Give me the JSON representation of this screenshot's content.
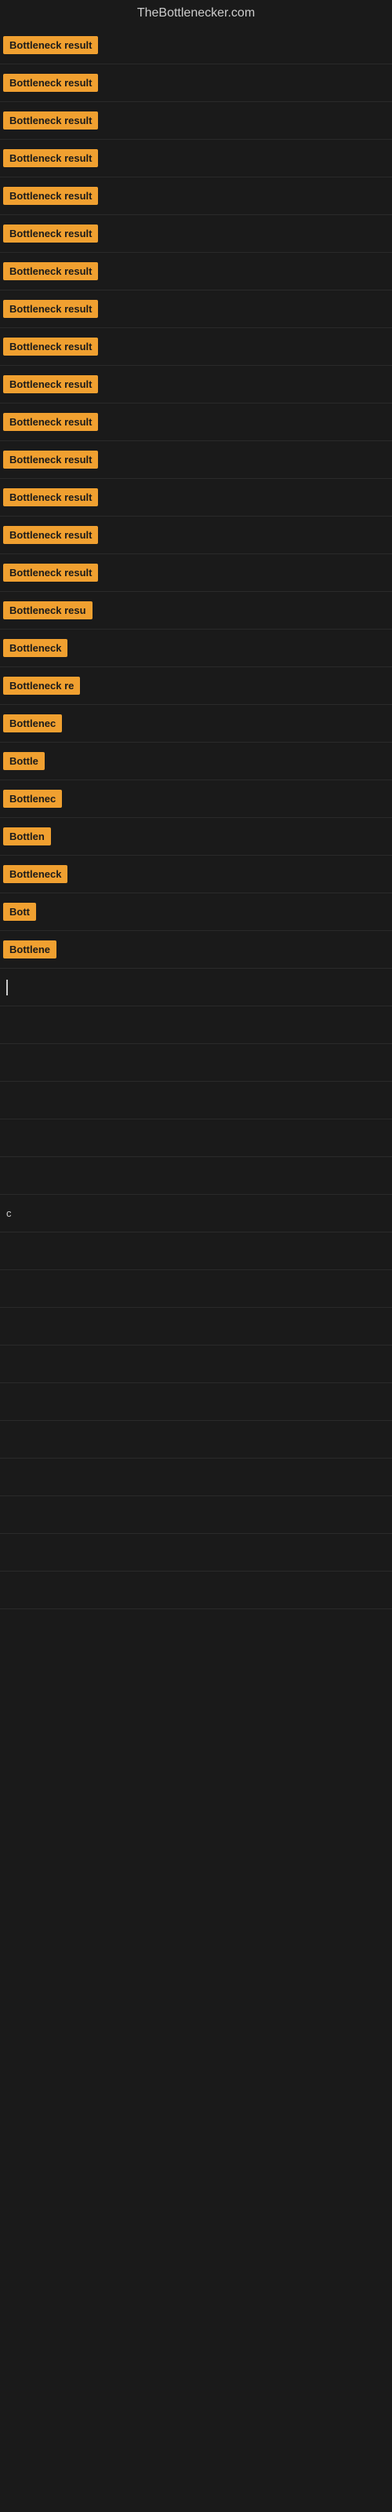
{
  "site": {
    "title": "TheBottlenecker.com"
  },
  "rows": [
    {
      "label": "Bottleneck result",
      "visible_chars": 17,
      "row_type": "full"
    },
    {
      "label": "Bottleneck result",
      "visible_chars": 17,
      "row_type": "full"
    },
    {
      "label": "Bottleneck result",
      "visible_chars": 17,
      "row_type": "full"
    },
    {
      "label": "Bottleneck result",
      "visible_chars": 17,
      "row_type": "full"
    },
    {
      "label": "Bottleneck result",
      "visible_chars": 17,
      "row_type": "full"
    },
    {
      "label": "Bottleneck result",
      "visible_chars": 17,
      "row_type": "full"
    },
    {
      "label": "Bottleneck result",
      "visible_chars": 17,
      "row_type": "full"
    },
    {
      "label": "Bottleneck result",
      "visible_chars": 17,
      "row_type": "full"
    },
    {
      "label": "Bottleneck result",
      "visible_chars": 17,
      "row_type": "full"
    },
    {
      "label": "Bottleneck result",
      "visible_chars": 17,
      "row_type": "full"
    },
    {
      "label": "Bottleneck result",
      "visible_chars": 17,
      "row_type": "full"
    },
    {
      "label": "Bottleneck result",
      "visible_chars": 17,
      "row_type": "full"
    },
    {
      "label": "Bottleneck result",
      "visible_chars": 17,
      "row_type": "full"
    },
    {
      "label": "Bottleneck result",
      "visible_chars": 17,
      "row_type": "full"
    },
    {
      "label": "Bottleneck result",
      "visible_chars": 17,
      "row_type": "full"
    },
    {
      "label": "Bottleneck resu",
      "visible_chars": 15,
      "row_type": "partial"
    },
    {
      "label": "Bottleneck",
      "visible_chars": 10,
      "row_type": "short"
    },
    {
      "label": "Bottleneck re",
      "visible_chars": 13,
      "row_type": "partial2"
    },
    {
      "label": "Bottlenec",
      "visible_chars": 9,
      "row_type": "shorter"
    },
    {
      "label": "Bottle",
      "visible_chars": 6,
      "row_type": "vshort"
    },
    {
      "label": "Bottlenec",
      "visible_chars": 9,
      "row_type": "shorter"
    },
    {
      "label": "Bottlen",
      "visible_chars": 7,
      "row_type": "shorter2"
    },
    {
      "label": "Bottleneck",
      "visible_chars": 10,
      "row_type": "short"
    },
    {
      "label": "Bott",
      "visible_chars": 4,
      "row_type": "vvshort"
    },
    {
      "label": "Bottlene",
      "visible_chars": 8,
      "row_type": "shorter3"
    },
    {
      "label": "cursor",
      "visible_chars": 0,
      "row_type": "cursor"
    },
    {
      "label": "",
      "visible_chars": 0,
      "row_type": "empty"
    },
    {
      "label": "",
      "visible_chars": 0,
      "row_type": "empty"
    },
    {
      "label": "",
      "visible_chars": 0,
      "row_type": "empty"
    },
    {
      "label": "",
      "visible_chars": 0,
      "row_type": "empty"
    },
    {
      "label": "",
      "visible_chars": 0,
      "row_type": "empty"
    },
    {
      "label": "c",
      "visible_chars": 1,
      "row_type": "single_char"
    },
    {
      "label": "",
      "visible_chars": 0,
      "row_type": "empty"
    },
    {
      "label": "",
      "visible_chars": 0,
      "row_type": "empty"
    },
    {
      "label": "",
      "visible_chars": 0,
      "row_type": "empty"
    },
    {
      "label": "",
      "visible_chars": 0,
      "row_type": "empty"
    },
    {
      "label": "",
      "visible_chars": 0,
      "row_type": "empty"
    },
    {
      "label": "",
      "visible_chars": 0,
      "row_type": "empty"
    },
    {
      "label": "",
      "visible_chars": 0,
      "row_type": "empty"
    },
    {
      "label": "",
      "visible_chars": 0,
      "row_type": "empty"
    },
    {
      "label": "",
      "visible_chars": 0,
      "row_type": "empty"
    },
    {
      "label": "",
      "visible_chars": 0,
      "row_type": "empty"
    }
  ],
  "badge_color": "#f0a030",
  "bg_color": "#1a1a1a"
}
